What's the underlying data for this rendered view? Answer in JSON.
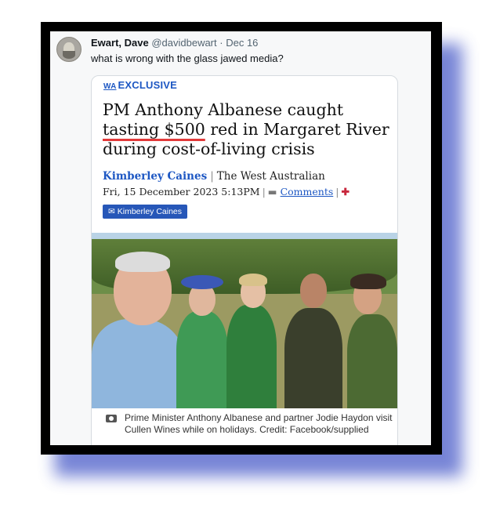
{
  "tweet": {
    "name": "Ewart, Dave",
    "handle": "@davidbewart",
    "separator": "·",
    "date": "Dec 16",
    "text": "what is wrong with the glass jawed media?"
  },
  "article": {
    "label_logo": "WA",
    "label": "EXCLUSIVE",
    "headline_part1": "PM Anthony Albanese caught ",
    "headline_highlight": "tasting $500",
    "headline_part2": " red in Margaret River during cost-of-living crisis",
    "author": "Kimberley Caines",
    "byline_sep": "|",
    "publication": "The West Australian",
    "date": "Fri, 15 December 2023 5:13PM",
    "date_sep": "|",
    "comments": "Comments",
    "author_button": "Kimberley Caines",
    "caption": "Prime Minister Anthony Albanese and partner Jodie Haydon visit Cullen Wines while on holidays. Credit: Facebook/supplied"
  },
  "colors": {
    "accent_blue": "#1d57c3",
    "frame_shadow": "#5566cc",
    "underline_red": "#e23a3a"
  }
}
